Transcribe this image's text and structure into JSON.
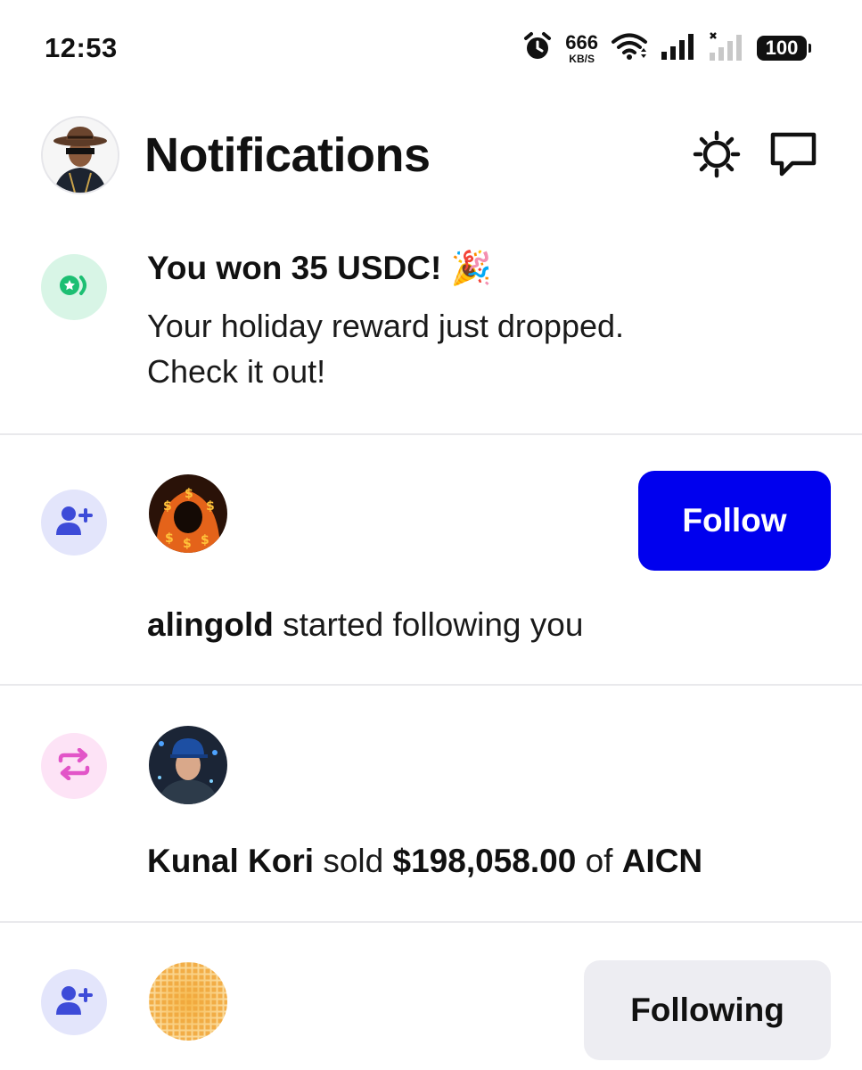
{
  "status_bar": {
    "time": "12:53",
    "net_speed_value": "666",
    "net_speed_unit": "KB/S",
    "battery": "100",
    "icons": [
      "alarm-icon",
      "wifi-icon",
      "signal-icon",
      "signal-no-service-icon",
      "battery-icon"
    ]
  },
  "header": {
    "title": "Notifications",
    "icons": [
      "profile-avatar",
      "settings-icon",
      "messages-icon"
    ]
  },
  "notifications": [
    {
      "type": "reward",
      "icon": "reward-coin-icon",
      "icon_bg": "#d8f5e6",
      "icon_color": "#1dbf73",
      "title": "You won 35 USDC! 🎉",
      "body_line1": "Your holiday reward just dropped.",
      "body_line2": "Check it out!"
    },
    {
      "type": "follow",
      "icon": "add-user-icon",
      "icon_bg": "#e3e5fb",
      "icon_color": "#3d4bd8",
      "user": "alingold",
      "text": "started following you",
      "button": "Follow",
      "button_color": "#0000ee"
    },
    {
      "type": "trade",
      "icon": "swap-icon",
      "icon_bg": "#fde3f6",
      "icon_color": "#e255c8",
      "user": "Kunal Kori",
      "verb": "sold",
      "amount": "$198,058.00",
      "preposition": "of",
      "token": "AICN"
    },
    {
      "type": "follow",
      "icon": "add-user-icon",
      "icon_bg": "#e3e5fb",
      "icon_color": "#3d4bd8",
      "button": "Following"
    }
  ]
}
